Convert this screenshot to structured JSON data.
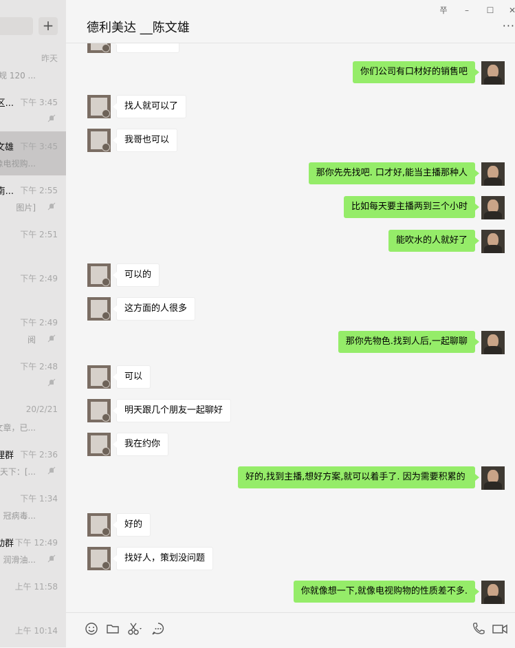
{
  "window": {
    "controls": [
      "쭈",
      "–",
      "☐",
      "✕"
    ]
  },
  "sidebar": {
    "add_label": "+",
    "sessions": [
      {
        "name": "",
        "time": "昨天",
        "preview": "规 120 ...",
        "muted": false,
        "selected": false
      },
      {
        "name": "区...",
        "time": "下午 3:45",
        "preview": "",
        "muted": true,
        "selected": false
      },
      {
        "name": "文雄",
        "time": "下午 3:45",
        "preview": "像电视购...",
        "muted": false,
        "selected": true
      },
      {
        "name": "南...",
        "time": "下午 2:55",
        "preview": "图片]",
        "muted": true,
        "selected": false
      },
      {
        "name": "",
        "time": "下午 2:51",
        "preview": "",
        "muted": false,
        "selected": false
      },
      {
        "name": "",
        "time": "下午 2:49",
        "preview": "",
        "muted": false,
        "selected": false
      },
      {
        "name": "",
        "time": "下午 2:49",
        "preview": "阅",
        "muted": true,
        "selected": false
      },
      {
        "name": "",
        "time": "下午 2:48",
        "preview": "",
        "muted": true,
        "selected": false
      },
      {
        "name": "",
        "time": "20/2/21",
        "preview": "文章，已...",
        "muted": false,
        "selected": false
      },
      {
        "name": "理群",
        "time": "下午 2:36",
        "preview": "天下：[...",
        "muted": true,
        "selected": false
      },
      {
        "name": "",
        "time": "下午 1:34",
        "preview": "冠病毒...",
        "muted": false,
        "selected": false
      },
      {
        "name": "动群",
        "time": "下午 12:49",
        "preview": "润滑油...",
        "muted": true,
        "selected": false
      },
      {
        "name": "",
        "time": "上午 11:58",
        "preview": "",
        "muted": false,
        "selected": false
      },
      {
        "name": "",
        "time": "上午 10:14",
        "preview": "",
        "muted": false,
        "selected": false
      }
    ]
  },
  "chat": {
    "title": "德利美达 __陈文雄",
    "more_label": "···",
    "messages": [
      {
        "from": "other",
        "text": ""
      },
      {
        "from": "me",
        "text": "你们公司有口材好的销售吧"
      },
      {
        "from": "other",
        "text": "找人就可以了"
      },
      {
        "from": "other",
        "text": "我哥也可以"
      },
      {
        "from": "me",
        "text": "那你先先找吧. 口才好,能当主播那种人"
      },
      {
        "from": "me",
        "text": "比如每天要主播两到三个小时"
      },
      {
        "from": "me",
        "text": "能吹水的人就好了"
      },
      {
        "from": "other",
        "text": "可以的"
      },
      {
        "from": "other",
        "text": "这方面的人很多"
      },
      {
        "from": "me",
        "text": "那你先物色.找到人后,一起聊聊"
      },
      {
        "from": "other",
        "text": "可以"
      },
      {
        "from": "other",
        "text": "明天跟几个朋友一起聊好"
      },
      {
        "from": "other",
        "text": "我在约你"
      },
      {
        "from": "me",
        "text": "好的,找到主播,想好方案,就可以着手了. 因为需要积累的"
      },
      {
        "from": "other",
        "text": "好的"
      },
      {
        "from": "other",
        "text": "找好人，策划没问题"
      },
      {
        "from": "me",
        "text": "你就像想一下,就像电视购物的性质差不多."
      }
    ]
  },
  "toolbar": {
    "icons": [
      "emoji-icon",
      "folder-icon",
      "scissors-icon",
      "chat-bubble-icon",
      "phone-icon",
      "video-icon"
    ]
  },
  "colors": {
    "my_bubble": "#95ec69",
    "other_bubble": "#ffffff",
    "background": "#f5f5f5",
    "sidebar": "#e6e5e5"
  }
}
